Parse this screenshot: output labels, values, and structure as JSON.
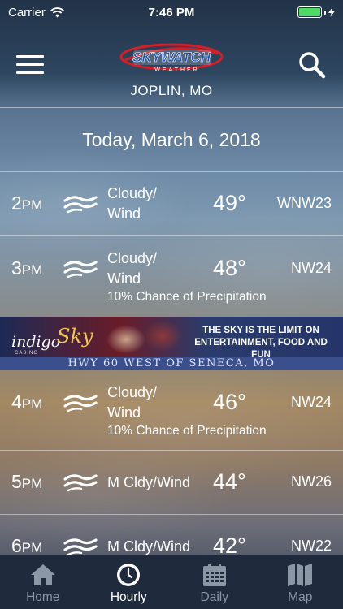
{
  "status_bar": {
    "carrier": "Carrier",
    "time": "7:46 PM",
    "battery_color": "#4cd964"
  },
  "header": {
    "logo_text": "SKYWATCH",
    "logo_subtext": "WEATHER",
    "location": "JOPLIN, MO"
  },
  "date_heading": "Today, March 6, 2018",
  "hours": [
    {
      "hour": "2",
      "ampm": "PM",
      "condition": "Cloudy/\nWind",
      "temp": "49°",
      "wind": "WNW23",
      "precip": ""
    },
    {
      "hour": "3",
      "ampm": "PM",
      "condition": "Cloudy/\nWind",
      "temp": "48°",
      "wind": "NW24",
      "precip": "10% Chance of Precipitation"
    },
    {
      "hour": "4",
      "ampm": "PM",
      "condition": "Cloudy/\nWind",
      "temp": "46°",
      "wind": "NW24",
      "precip": "10% Chance of Precipitation"
    },
    {
      "hour": "5",
      "ampm": "PM",
      "condition": "M Cldy/Wind",
      "temp": "44°",
      "wind": "NW26",
      "precip": ""
    },
    {
      "hour": "6",
      "ampm": "PM",
      "condition": "M Cldy/Wind",
      "temp": "42°",
      "wind": "NW22",
      "precip": ""
    }
  ],
  "ad": {
    "brand_left": "indigo",
    "brand_right": "Sky",
    "brand_sub": "CASINO",
    "tagline": "THE SKY IS THE LIMIT ON ENTERTAINMENT, FOOD AND FUN",
    "strip": "HWY 60 WEST OF SENECA, MO"
  },
  "tabs": [
    {
      "label": "Home",
      "icon": "home-icon"
    },
    {
      "label": "Hourly",
      "icon": "clock-icon",
      "active": true
    },
    {
      "label": "Daily",
      "icon": "calendar-icon"
    },
    {
      "label": "Map",
      "icon": "map-icon"
    }
  ],
  "colors": {
    "tabbar": "#1f2b3c",
    "tab_inactive": "#8c97a6",
    "accent_red": "#d0202a",
    "logo_blue": "#1a4fb0"
  }
}
